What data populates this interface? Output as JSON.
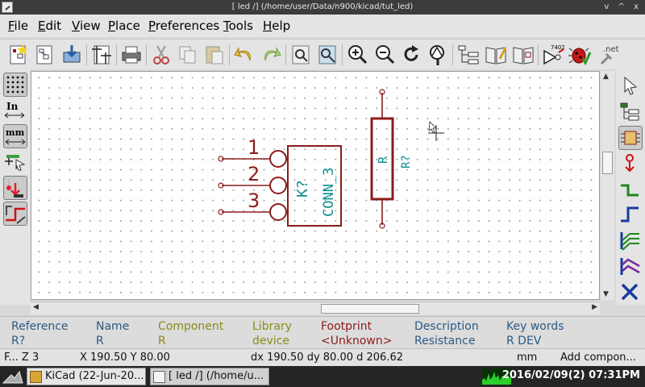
{
  "window": {
    "title": "[ led /] (/home/user/Data/n900/kicad/tut_led)",
    "controls": "v ^ x"
  },
  "menu": [
    "File",
    "Edit",
    "View",
    "Place",
    "Preferences",
    "Tools",
    "Help"
  ],
  "toolbar": {
    "icons": [
      "new-sheet",
      "open-sheet",
      "save",
      "page-settings",
      "print",
      "cut",
      "copy",
      "paste",
      "undo",
      "redo",
      "find",
      "find-replace",
      "zoom-in",
      "zoom-out",
      "redraw",
      "zoom-fit",
      "hierarchy",
      "library-editor",
      "library-browser",
      "netlist",
      "erc",
      "bom"
    ],
    "netlist_badge": "7402",
    "net_badge": ".net"
  },
  "left_toolbar": {
    "units_in": "In",
    "units_mm": "mm"
  },
  "schematic": {
    "connector": {
      "reference": "K?",
      "value": "CONN_3",
      "pins": [
        "1",
        "2",
        "3"
      ]
    },
    "resistor": {
      "reference": "R?",
      "value": "R"
    }
  },
  "info_panel": {
    "columns": [
      {
        "label": "Reference",
        "value": "R?",
        "color": "#2a5a84"
      },
      {
        "label": "Name",
        "value": "R",
        "color": "#2a5a84"
      },
      {
        "label": "Component",
        "value": "R",
        "color": "#8a8a1c"
      },
      {
        "label": "Library",
        "value": "device",
        "color": "#8a8a1c"
      },
      {
        "label": "Footprint",
        "value": "<Unknown>",
        "color": "#8b1c1c"
      },
      {
        "label": "Description",
        "value": "Resistance",
        "color": "#2a5a84"
      },
      {
        "label": "Key words",
        "value": "R DEV",
        "color": "#2a5a84"
      }
    ]
  },
  "status": {
    "zoom": "F... Z 3",
    "xy": "X 190.50  Y 80.00",
    "delta": "dx 190.50  dy 80.00  d 206.62",
    "units": "mm",
    "mode": "Add compon..."
  },
  "taskbar": {
    "tasks": [
      "KiCad (22-Jun-20...",
      "[ led /] (/home/u..."
    ],
    "clock": "2016/02/09(2) 07:31PM"
  },
  "colors": {
    "wire": "#8b1c1c",
    "field": "#0e8e8e",
    "grid": "#9a9a9a"
  }
}
